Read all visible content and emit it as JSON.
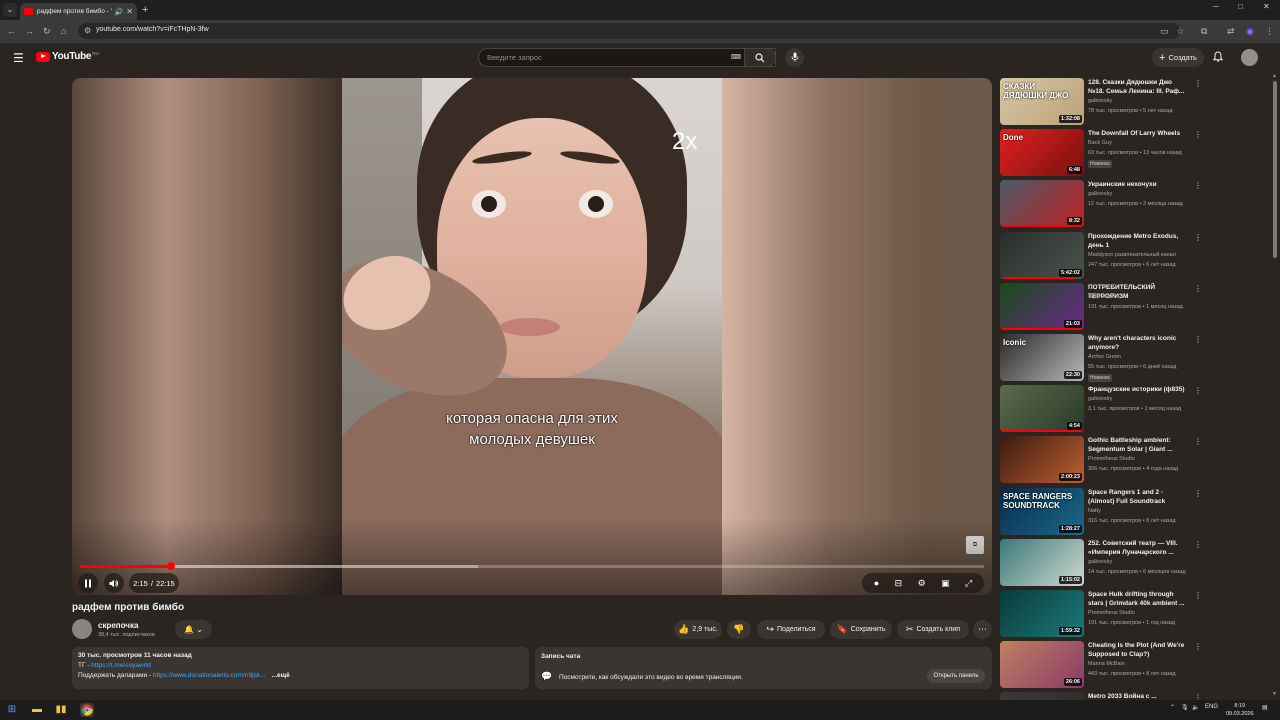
{
  "browser": {
    "tab_title": "радфем против бимбо - YouTube",
    "url": "youtube.com/watch?v=iFcTHpN-3fw",
    "new_tab_label": "+",
    "minimize": "─",
    "maximize": "□",
    "close": "✕"
  },
  "masthead": {
    "logo_text": "YouTube",
    "logo_region": "RU",
    "search_placeholder": "Введите запрос",
    "create_label": "Создать"
  },
  "player": {
    "speed_overlay": "2x",
    "caption_line1": "которая опасна для этих",
    "caption_line2": "молодых девушек",
    "time_current": "2:15",
    "time_separator": "/",
    "time_total": "22:15",
    "played_fraction": 0.101,
    "loaded_fraction": 0.44
  },
  "video": {
    "title": "радфем против бимбо",
    "channel_name": "скрепочка",
    "channel_subs": "38,4 тыс. подписчиков",
    "likes": "2,9 тыс.",
    "share_label": "Поделиться",
    "save_label": "Сохранить",
    "clip_label": "Создать клип",
    "description": {
      "meta": "30 тыс. просмотров  11 часов назад",
      "line1_prefix": "ТГ - ",
      "line1_link": "https://t.me/soyawrld",
      "line2_prefix": "Поддержать даларами - ",
      "line2_link": "https://www.donationalerts.com/r/djsk...",
      "more_label": "...ещё"
    },
    "chat": {
      "heading": "Запись чата",
      "text": "Посмотрите, как обсуждали это видео во время трансляции.",
      "open_label": "Открыть панель"
    }
  },
  "recommendations": [
    {
      "title": "128. Сказки Дядюшки Джо №18. Семья Ленина: III. Раф...",
      "channel": "galkovsky",
      "views": "78 тыс. просмотров • 5 лет назад",
      "duration": "1:32:08",
      "badge": "",
      "progress": 0.0,
      "thumb_colors": [
        "#d9c7a2",
        "#b9a27a"
      ],
      "thumb_text": "СКАЗКИ ДЯДЮШКИ ДЖО"
    },
    {
      "title": "The Downfall Of Larry Wheels",
      "channel": "Back Guy",
      "views": "63 тыс. просмотров • 13 часов назад",
      "duration": "6:48",
      "badge": "Новинка",
      "progress": 0.0,
      "thumb_colors": [
        "#e02020",
        "#7a1010"
      ],
      "thumb_text": "Done"
    },
    {
      "title": "Украинские нехочухи",
      "channel": "galkovsky",
      "views": "12 тыс. просмотров • 3 месяца назад",
      "duration": "8:32",
      "badge": "",
      "progress": 1.0,
      "thumb_colors": [
        "#4a5a6a",
        "#c02020"
      ],
      "thumb_text": ""
    },
    {
      "title": "Прохождение Metro Exodus, день 1",
      "channel": "Maddyson развлекательный канал",
      "views": "247 тыс. просмотров • 6 лет назад",
      "duration": "5:42:02",
      "badge": "",
      "progress": 0.9,
      "thumb_colors": [
        "#2a2e2c",
        "#4b524d"
      ],
      "thumb_text": ""
    },
    {
      "title": "ПОТРЕБИТЕЛЬСКИЙ ТЕРРОРИЗМ",
      "channel": "скрепочка",
      "views": "191 тыс. просмотров • 1 месяц назад",
      "duration": "21:03",
      "badge": "",
      "progress": 1.0,
      "thumb_colors": [
        "#1a4a1a",
        "#6a2a8a"
      ],
      "thumb_text": ""
    },
    {
      "title": "Why aren't characters iconic anymore?",
      "channel": "Archer Green",
      "views": "55 тыс. просмотров • 6 дней назад",
      "duration": "22:30",
      "badge": "Новинка",
      "progress": 0.0,
      "thumb_colors": [
        "#2a2a2a",
        "#b8b8b8"
      ],
      "thumb_text": "Iconic"
    },
    {
      "title": "Французские историки (ф835)",
      "channel": "galkovsky",
      "views": "3,1 тыс. просмотров • 1 месяц назад",
      "duration": "4:54",
      "badge": "",
      "progress": 1.0,
      "thumb_colors": [
        "#5a6a4a",
        "#2a3a2a"
      ],
      "thumb_text": ""
    },
    {
      "title": "Gothic Battleship ambient: Segmentum Solar | Giant ...",
      "channel": "Prometheus Studio",
      "views": "306 тыс. просмотров • 4 года назад",
      "duration": "2:00:23",
      "badge": "",
      "progress": 0.0,
      "thumb_colors": [
        "#3a1a10",
        "#c06030"
      ],
      "thumb_text": ""
    },
    {
      "title": "Space Rangers 1 and 2 - (Almost) Full Soundtrack",
      "channel": "Natty",
      "views": "316 тыс. просмотров • 8 лет назад",
      "duration": "1:28:27",
      "badge": "",
      "progress": 0.0,
      "thumb_colors": [
        "#0a2a4a",
        "#1a6a8a"
      ],
      "thumb_text": "SPACE RANGERS SOUNDTRACK"
    },
    {
      "title": "252. Советский театр — VIII. «Империя Луначарского ...",
      "channel": "galkovsky",
      "views": "14 тыс. просмотров • 6 месяцев назад",
      "duration": "1:15:02",
      "badge": "",
      "progress": 0.0,
      "thumb_colors": [
        "#3a7a7a",
        "#d0d8d0"
      ],
      "thumb_text": ""
    },
    {
      "title": "Space Hulk drifting through stars | Grimdark 40k ambient ...",
      "channel": "Prometheus Studio",
      "views": "191 тыс. просмотров • 1 год назад",
      "duration": "1:59:32",
      "badge": "",
      "progress": 0.0,
      "thumb_colors": [
        "#0a3a3a",
        "#1a7a7a"
      ],
      "thumb_text": ""
    },
    {
      "title": "Cheating Is the Plot (And We're Supposed to Clap?)",
      "channel": "Manna McBain",
      "views": "443 тыс. просмотров • 8 лет назад",
      "duration": "26:06",
      "badge": "",
      "progress": 0.0,
      "thumb_colors": [
        "#c08060",
        "#8a3a6a"
      ],
      "thumb_text": ""
    },
    {
      "title": "Metro 2033 Война с ...",
      "channel": "",
      "views": "",
      "duration": "",
      "badge": "",
      "progress": 0.0,
      "thumb_colors": [
        "#3a3a3a",
        "#2a2a2a"
      ],
      "thumb_text": ""
    }
  ],
  "taskbar": {
    "lang": "ENG",
    "time": "8:19",
    "date": "09.03.2026"
  }
}
